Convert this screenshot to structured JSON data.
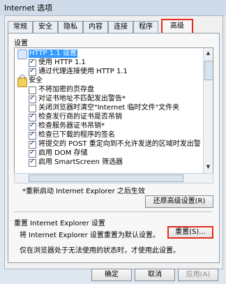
{
  "window": {
    "title": "Internet 选项"
  },
  "tabs": [
    "常规",
    "安全",
    "隐私",
    "内容",
    "连接",
    "程序",
    "高级"
  ],
  "panel": {
    "section_settings": "设置",
    "settings": [
      {
        "type": "header",
        "label": "HTTP 1.1 设置",
        "selected": true
      },
      {
        "type": "checkbox",
        "checked": true,
        "label": "使用 HTTP 1.1"
      },
      {
        "type": "checkbox",
        "checked": true,
        "label": "通过代理连接使用 HTTP 1.1"
      },
      {
        "type": "header",
        "label": "安全",
        "icon": "lock-icon"
      },
      {
        "type": "checkbox",
        "checked": false,
        "label": "不将加密的页存盘"
      },
      {
        "type": "checkbox",
        "checked": true,
        "label": "对证书地址不匹配发出警告*"
      },
      {
        "type": "checkbox",
        "checked": false,
        "label": "关闭浏览器时清空\"Internet 临时文件\"文件夹"
      },
      {
        "type": "checkbox",
        "checked": true,
        "label": "检查发行商的证书是否吊销"
      },
      {
        "type": "checkbox",
        "checked": true,
        "label": "检查服务器证书吊销*"
      },
      {
        "type": "checkbox",
        "checked": true,
        "label": "检查已下载的程序的签名"
      },
      {
        "type": "checkbox",
        "checked": true,
        "label": "将提交的 POST 重定向到不允许发送的区域时发出警"
      },
      {
        "type": "checkbox",
        "checked": true,
        "label": "启用 DOM 存储"
      },
      {
        "type": "checkbox",
        "checked": true,
        "label": "启用 SmartScreen 筛选器"
      }
    ],
    "restart_note": "*重新启动 Internet Explorer 之后生效",
    "restore_advanced_button": "还原高级设置(R)",
    "reset_section": "重置 Internet Explorer 设置",
    "reset_description": "将 Internet Explorer 设置重置为默认设置。",
    "reset_button": "重置(S)...",
    "reset_note": "仅在浏览器处于无法使用的状态时，才使用此设置。"
  },
  "footer": {
    "ok": "确定",
    "cancel": "取消",
    "apply": "应用(A)"
  },
  "colors": {
    "highlight": "#e32c1e",
    "selection": "#3399ff"
  }
}
